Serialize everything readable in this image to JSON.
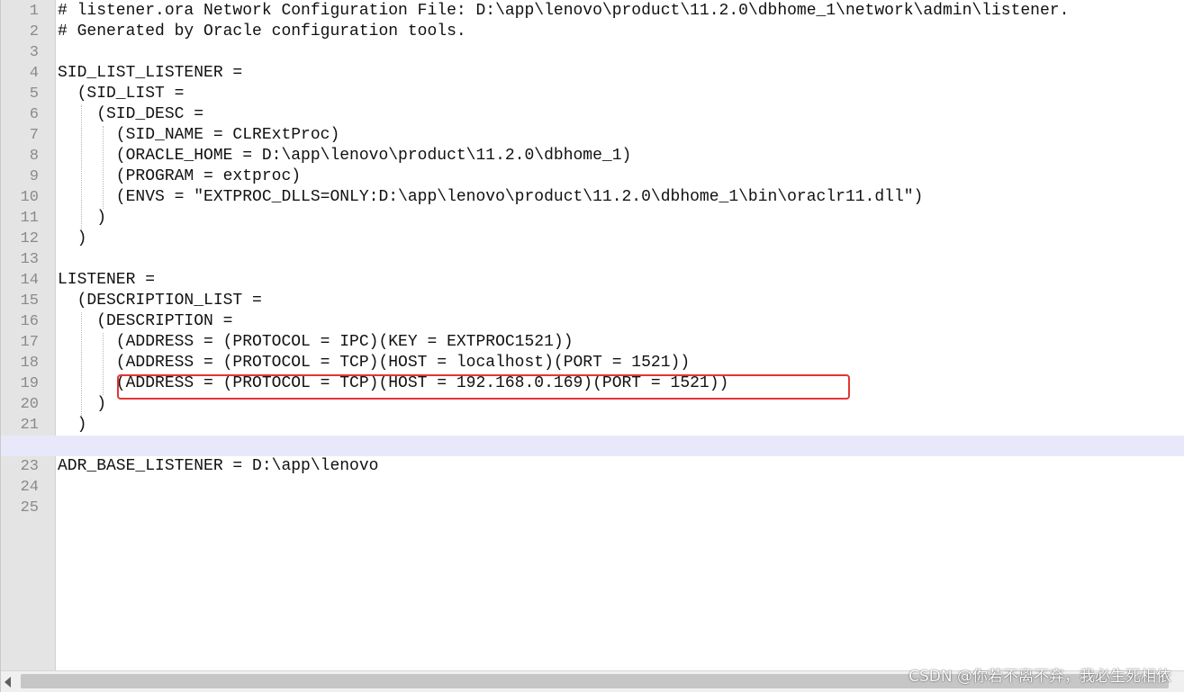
{
  "editor": {
    "current_line": 22,
    "highlight_line": 19,
    "lines": [
      "# listener.ora Network Configuration File: D:\\app\\lenovo\\product\\11.2.0\\dbhome_1\\network\\admin\\listener.",
      "# Generated by Oracle configuration tools.",
      "",
      "SID_LIST_LISTENER =",
      "  (SID_LIST =",
      "    (SID_DESC =",
      "      (SID_NAME = CLRExtProc)",
      "      (ORACLE_HOME = D:\\app\\lenovo\\product\\11.2.0\\dbhome_1)",
      "      (PROGRAM = extproc)",
      "      (ENVS = \"EXTPROC_DLLS=ONLY:D:\\app\\lenovo\\product\\11.2.0\\dbhome_1\\bin\\oraclr11.dll\")",
      "    )",
      "  )",
      "",
      "LISTENER =",
      "  (DESCRIPTION_LIST =",
      "    (DESCRIPTION =",
      "      (ADDRESS = (PROTOCOL = IPC)(KEY = EXTPROC1521))",
      "      (ADDRESS = (PROTOCOL = TCP)(HOST = localhost)(PORT = 1521))",
      "      (ADDRESS = (PROTOCOL = TCP)(HOST = 192.168.0.169)(PORT = 1521))",
      "    )",
      "  )",
      "",
      "ADR_BASE_LISTENER = D:\\app\\lenovo",
      "",
      ""
    ]
  },
  "watermark": "CSDN @你若不离不弃，我必生死相依",
  "colors": {
    "gutter_bg": "#e4e4e4",
    "current_line_bg": "#e8e8fa",
    "highlight_border": "#e33535"
  }
}
